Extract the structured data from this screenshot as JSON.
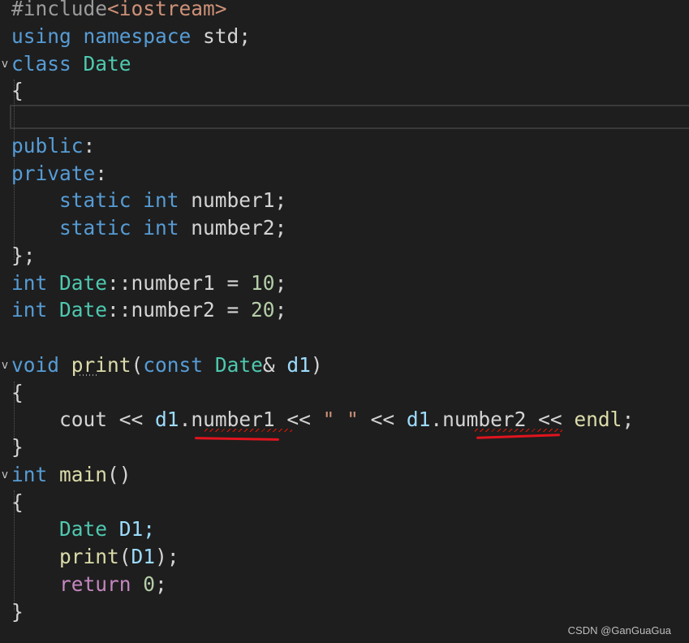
{
  "editor": {
    "theme_colors": {
      "keyword": "#569cd6",
      "control": "#c586c0",
      "type": "#4ec9b0",
      "function": "#dcdcaa",
      "number": "#b5cea8",
      "string": "#ce9178",
      "plain": "#d4d4d4",
      "param": "#9cdcfe",
      "preprocessor": "#9b9b9b"
    },
    "lines": [
      {
        "fold": "",
        "tokens": [
          {
            "t": "#include",
            "c": "preprocessor"
          },
          {
            "t": "<iostream>",
            "c": "string"
          }
        ]
      },
      {
        "fold": "",
        "tokens": [
          {
            "t": "using ",
            "c": "keyword"
          },
          {
            "t": "namespace ",
            "c": "keyword"
          },
          {
            "t": "std;",
            "c": "plain"
          }
        ]
      },
      {
        "fold": "v",
        "tokens": [
          {
            "t": "class ",
            "c": "keyword"
          },
          {
            "t": "Date",
            "c": "type"
          }
        ]
      },
      {
        "fold": "",
        "tokens": [
          {
            "t": "{",
            "c": "plain"
          }
        ]
      },
      {
        "fold": "",
        "tokens": []
      },
      {
        "fold": "",
        "tokens": [
          {
            "t": "public",
            "c": "keyword"
          },
          {
            "t": ":",
            "c": "plain"
          }
        ]
      },
      {
        "fold": "",
        "tokens": [
          {
            "t": "private",
            "c": "keyword"
          },
          {
            "t": ":",
            "c": "plain"
          }
        ]
      },
      {
        "fold": "",
        "tokens": [
          {
            "t": "    ",
            "c": "plain"
          },
          {
            "t": "static ",
            "c": "keyword"
          },
          {
            "t": "int ",
            "c": "keyword"
          },
          {
            "t": "number1;",
            "c": "plain"
          }
        ]
      },
      {
        "fold": "",
        "tokens": [
          {
            "t": "    ",
            "c": "plain"
          },
          {
            "t": "static ",
            "c": "keyword"
          },
          {
            "t": "int ",
            "c": "keyword"
          },
          {
            "t": "number2;",
            "c": "plain"
          }
        ]
      },
      {
        "fold": "",
        "tokens": [
          {
            "t": "};",
            "c": "plain"
          }
        ]
      },
      {
        "fold": "",
        "tokens": [
          {
            "t": "int ",
            "c": "keyword"
          },
          {
            "t": "Date",
            "c": "type"
          },
          {
            "t": "::number1 = ",
            "c": "plain"
          },
          {
            "t": "10",
            "c": "number"
          },
          {
            "t": ";",
            "c": "plain"
          }
        ]
      },
      {
        "fold": "",
        "tokens": [
          {
            "t": "int ",
            "c": "keyword"
          },
          {
            "t": "Date",
            "c": "type"
          },
          {
            "t": "::number2 = ",
            "c": "plain"
          },
          {
            "t": "20",
            "c": "number"
          },
          {
            "t": ";",
            "c": "plain"
          }
        ]
      },
      {
        "fold": "",
        "tokens": []
      },
      {
        "fold": "v",
        "tokens": [
          {
            "t": "void ",
            "c": "keyword"
          },
          {
            "t": "print",
            "c": "function"
          },
          {
            "t": "(",
            "c": "plain"
          },
          {
            "t": "const ",
            "c": "keyword"
          },
          {
            "t": "Date",
            "c": "type"
          },
          {
            "t": "& ",
            "c": "plain"
          },
          {
            "t": "d1",
            "c": "param"
          },
          {
            "t": ")",
            "c": "plain"
          }
        ]
      },
      {
        "fold": "",
        "tokens": [
          {
            "t": "{",
            "c": "plain"
          }
        ]
      },
      {
        "fold": "",
        "tokens": [
          {
            "t": "    ",
            "c": "plain"
          },
          {
            "t": "cout",
            "c": "plain"
          },
          {
            "t": " << ",
            "c": "plain"
          },
          {
            "t": "d1",
            "c": "param"
          },
          {
            "t": ".number1",
            "c": "plain"
          },
          {
            "t": " << ",
            "c": "plain"
          },
          {
            "t": "\" \"",
            "c": "string"
          },
          {
            "t": " << ",
            "c": "plain"
          },
          {
            "t": "d1",
            "c": "param"
          },
          {
            "t": ".number2",
            "c": "plain"
          },
          {
            "t": " << ",
            "c": "plain"
          },
          {
            "t": "endl",
            "c": "function"
          },
          {
            "t": ";",
            "c": "plain"
          }
        ]
      },
      {
        "fold": "",
        "tokens": [
          {
            "t": "}",
            "c": "plain"
          }
        ]
      },
      {
        "fold": "v",
        "tokens": [
          {
            "t": "int ",
            "c": "keyword"
          },
          {
            "t": "main",
            "c": "function"
          },
          {
            "t": "()",
            "c": "plain"
          }
        ]
      },
      {
        "fold": "",
        "tokens": [
          {
            "t": "{",
            "c": "plain"
          }
        ]
      },
      {
        "fold": "",
        "tokens": [
          {
            "t": "    ",
            "c": "plain"
          },
          {
            "t": "Date ",
            "c": "type"
          },
          {
            "t": "D1;",
            "c": "param"
          }
        ]
      },
      {
        "fold": "",
        "tokens": [
          {
            "t": "    ",
            "c": "plain"
          },
          {
            "t": "print",
            "c": "function"
          },
          {
            "t": "(",
            "c": "plain"
          },
          {
            "t": "D1",
            "c": "param"
          },
          {
            "t": ");",
            "c": "plain"
          }
        ]
      },
      {
        "fold": "",
        "tokens": [
          {
            "t": "    ",
            "c": "plain"
          },
          {
            "t": "return ",
            "c": "control"
          },
          {
            "t": "0",
            "c": "number"
          },
          {
            "t": ";",
            "c": "plain"
          }
        ]
      },
      {
        "fold": "",
        "tokens": [
          {
            "t": "}",
            "c": "plain"
          }
        ]
      }
    ]
  },
  "watermark": "CSDN @GanGuaGua"
}
